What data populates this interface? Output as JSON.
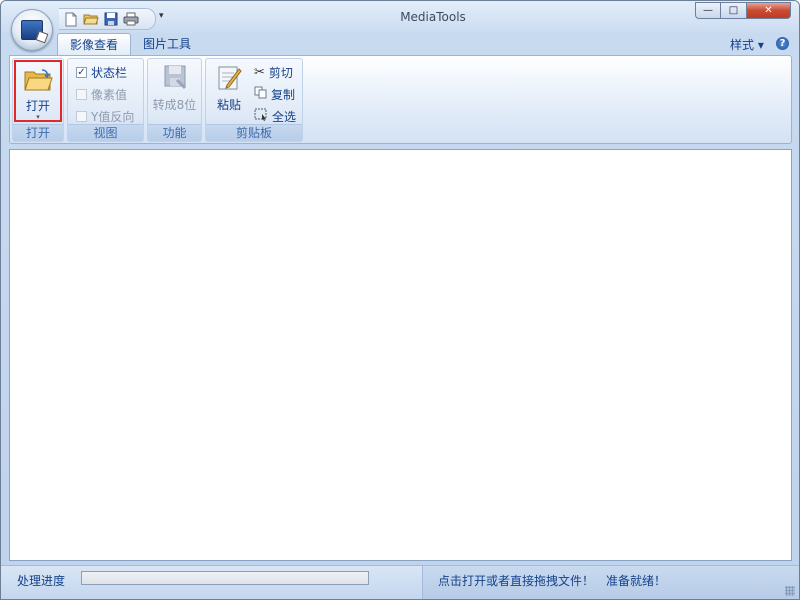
{
  "window": {
    "title": "MediaTools"
  },
  "title_controls": {
    "minimize": "—",
    "maximize": "□",
    "close": "✕"
  },
  "quick_access": {
    "icons": [
      "new-file-icon",
      "open-folder-icon",
      "save-icon",
      "print-icon"
    ],
    "dropdown": "▾"
  },
  "ribbon": {
    "tabs": [
      {
        "label": "影像查看",
        "active": true
      },
      {
        "label": "图片工具",
        "active": false
      }
    ],
    "style_menu": "样式 ▾",
    "help": "?",
    "groups": {
      "open": {
        "button": "打开",
        "label": "打开"
      },
      "view": {
        "label": "视图",
        "items": [
          {
            "label": "状态栏",
            "checked": true,
            "enabled": true
          },
          {
            "label": "像素值",
            "checked": false,
            "enabled": false
          },
          {
            "label": "Y值反向",
            "checked": false,
            "enabled": false
          }
        ]
      },
      "function": {
        "button": "转成8位",
        "label": "功能"
      },
      "clipboard": {
        "paste": "粘贴",
        "cut": "剪切",
        "copy": "复制",
        "select_all": "全选",
        "label": "剪贴板"
      }
    }
  },
  "status": {
    "progress_label": "处理进度",
    "progress": 0,
    "message": "点击打开或者直接拖拽文件！",
    "ready": "准备就绪！"
  }
}
